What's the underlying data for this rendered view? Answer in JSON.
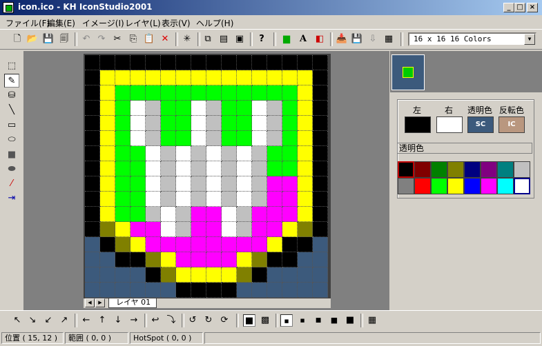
{
  "window": {
    "title": "icon.ico - KH IconStudio2001"
  },
  "menu": [
    "ファイル(F)",
    "編集(E)",
    "イメージ(I)",
    "レイヤ(L)",
    "表示(V)",
    "ヘルプ(H)"
  ],
  "color_mode": "16 x 16 16 Colors",
  "layer_tab": "レイヤ 01",
  "colors_panel": {
    "left_label": "左",
    "right_label": "右",
    "trans_label": "透明色",
    "invert_label": "反転色",
    "sc": "SC",
    "ic": "IC",
    "left_color": "#000000",
    "right_color": "#ffffff",
    "sc_color": "#3c5a7c",
    "ic_color": "#b9977f"
  },
  "trans_bar": "透明色",
  "palette": [
    "#000000",
    "#800000",
    "#008000",
    "#808000",
    "#000080",
    "#800080",
    "#008080",
    "#c0c0c0",
    "#808080",
    "#ff0000",
    "#00ff00",
    "#ffff00",
    "#0000ff",
    "#ff00ff",
    "#00ffff",
    "#ffffff"
  ],
  "status": {
    "pos": "位置 ( 15, 12 )",
    "range": "範囲 ( 0, 0 )",
    "hotspot": "HotSpot ( 0, 0 )"
  },
  "icon_pixels": [
    "KKKKKKKKKKKKKKKK",
    "KYYYYYYYYYYYYYYK",
    "KYGGGGGGGGGGGGYK",
    "KYGWSGGWSGGWSGYK",
    "KYGWSGGWSGGWSGYK",
    "KYGWSGGWSGGWSGYK",
    "KYGGWSWSWSWSGGYK",
    "KYGGWSWSWSWSGGYK",
    "KYGGWSWSWSWSMMYK",
    "KYGGWSWSWSWSMMYK",
    "KYGGSWSMMWSMMMYK",
    "KOYMMWSMMWSMMYOK",
    "BKOYMMMMMMMMYKKB",
    "BBKKOYMMMMYOKKBB",
    "BBBBKOYYYYOKBBBB",
    "BBBBBBKKKKBBBBBB"
  ],
  "pixel_colors": {
    "K": "#000000",
    "Y": "#ffff00",
    "G": "#00ff00",
    "W": "#ffffff",
    "S": "#c0c0c0",
    "M": "#ff00ff",
    "O": "#808000",
    "B": "#3c5a7c"
  }
}
